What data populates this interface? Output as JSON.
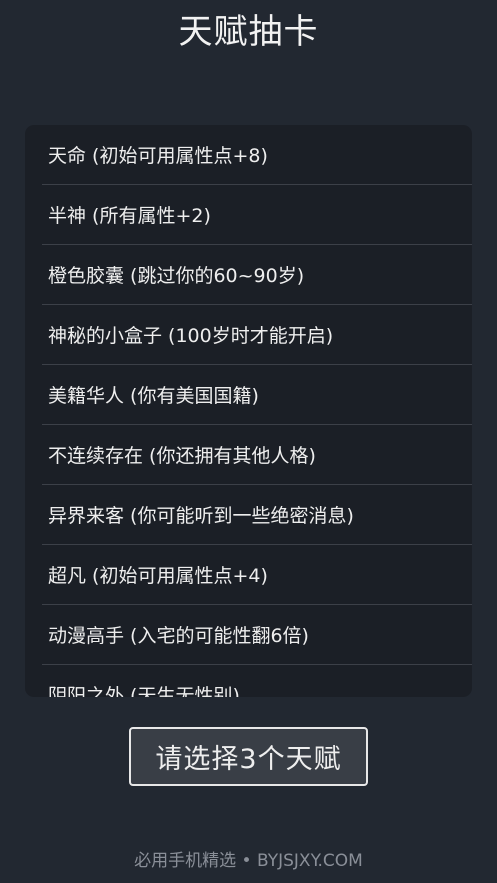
{
  "header": {
    "title": "天赋抽卡"
  },
  "talents": [
    "天命 (初始可用属性点+8)",
    "半神 (所有属性+2)",
    "橙色胶囊 (跳过你的60~90岁)",
    "神秘的小盒子 (100岁时才能开启)",
    "美籍华人 (你有美国国籍)",
    "不连续存在 (你还拥有其他人格)",
    "异界来客 (你可能听到一些绝密消息)",
    "超凡 (初始可用属性点+4)",
    "动漫高手 (入宅的可能性翻6倍)",
    "阴阳之外 (天生无性别)"
  ],
  "action": {
    "select_label": "请选择3个天赋"
  },
  "watermark": {
    "text": "必用手机精选 • BYJSJXY.COM"
  },
  "colors": {
    "background": "#222831",
    "panel": "#1b1f26",
    "divider": "#3c4048",
    "button_bg": "#393e46",
    "text": "#eeeeee"
  }
}
